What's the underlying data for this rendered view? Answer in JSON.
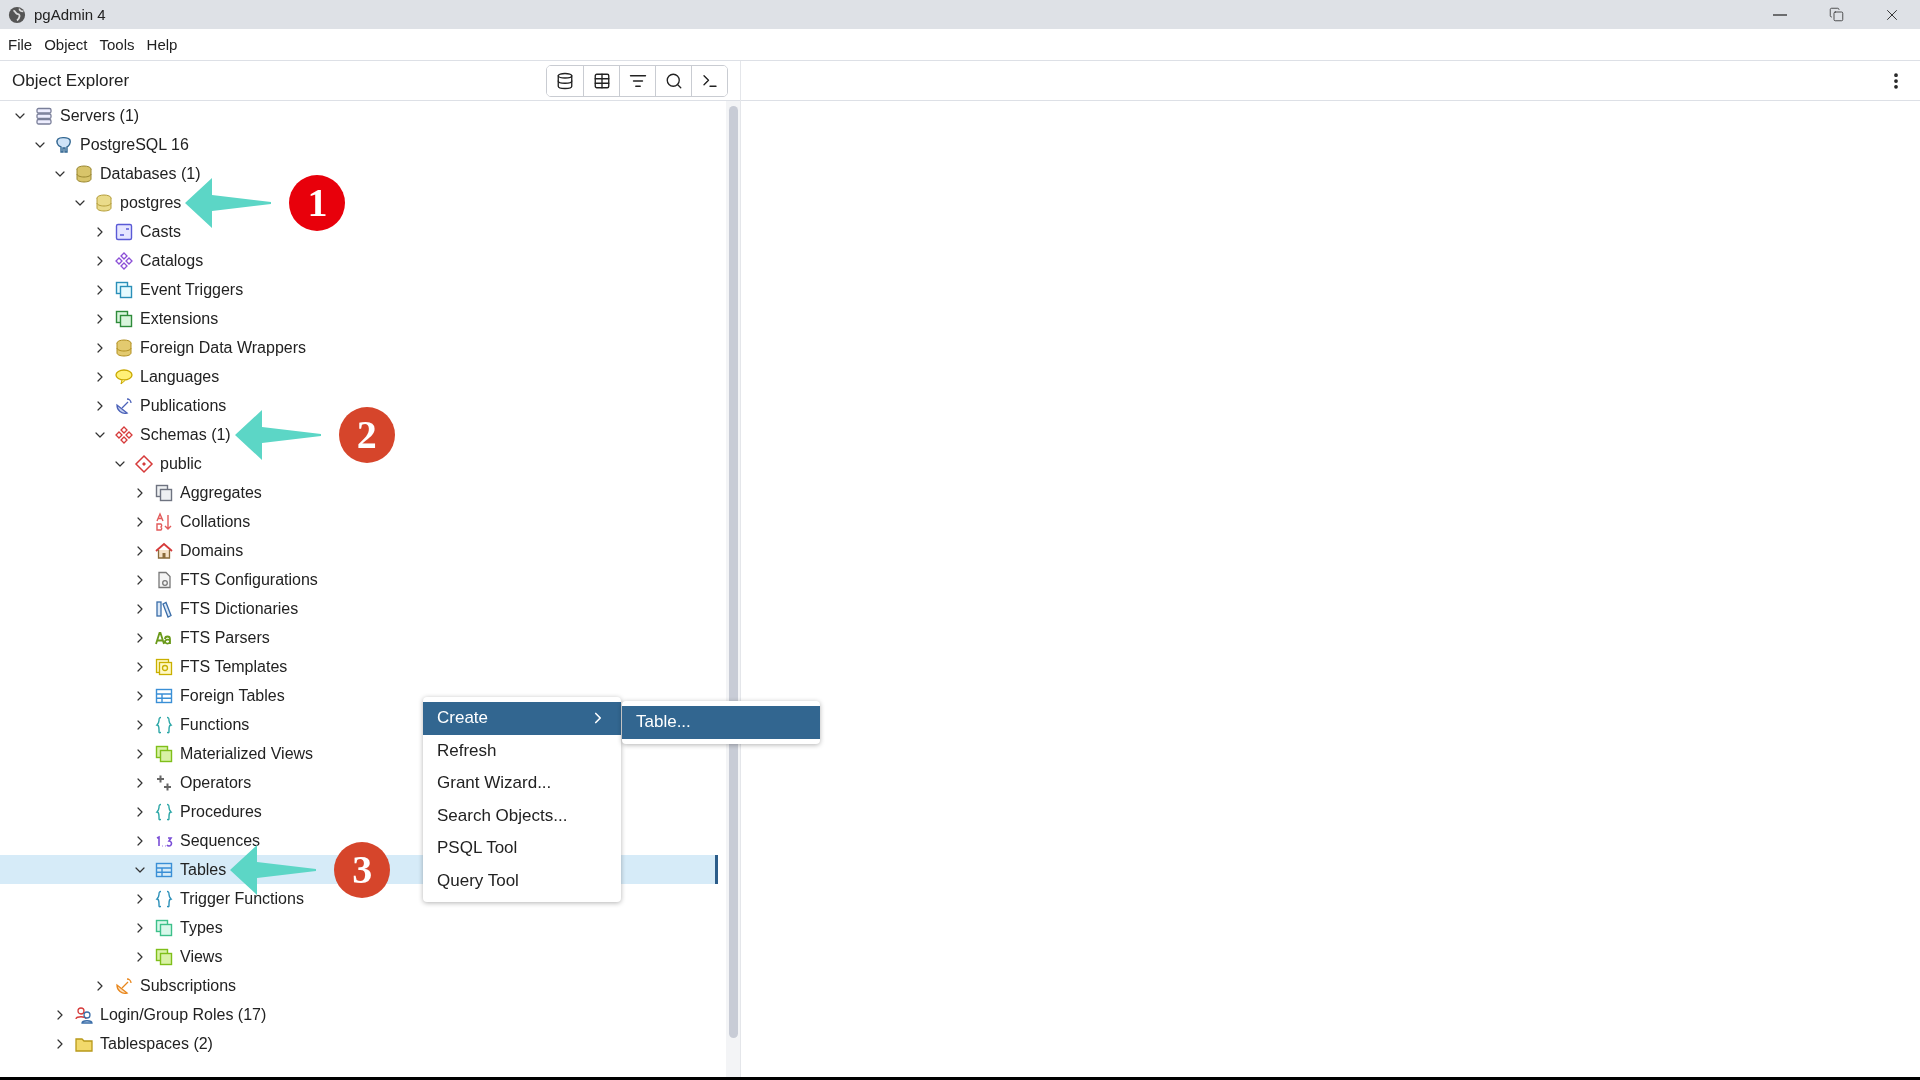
{
  "window": {
    "title": "pgAdmin 4"
  },
  "menu": [
    "File",
    "Object",
    "Tools",
    "Help"
  ],
  "explorer": {
    "title": "Object Explorer",
    "tree": [
      {
        "label": "Servers (1)",
        "kind": "servers",
        "expanded": true,
        "selected": false,
        "children": [
          {
            "label": "PostgreSQL 16",
            "kind": "server",
            "expanded": true,
            "selected": false,
            "children": [
              {
                "label": "Databases (1)",
                "kind": "databases",
                "expanded": true,
                "selected": false,
                "children": [
                  {
                    "label": "postgres",
                    "kind": "database",
                    "expanded": true,
                    "selected": false,
                    "callout": {
                      "label": "1",
                      "color": "#e8000b"
                    },
                    "children": [
                      {
                        "label": "Casts",
                        "kind": "casts",
                        "expanded": false,
                        "selected": false
                      },
                      {
                        "label": "Catalogs",
                        "kind": "catalogs",
                        "expanded": false,
                        "selected": false
                      },
                      {
                        "label": "Event Triggers",
                        "kind": "event_triggers",
                        "expanded": false,
                        "selected": false
                      },
                      {
                        "label": "Extensions",
                        "kind": "extensions",
                        "expanded": false,
                        "selected": false
                      },
                      {
                        "label": "Foreign Data Wrappers",
                        "kind": "fdw",
                        "expanded": false,
                        "selected": false
                      },
                      {
                        "label": "Languages",
                        "kind": "languages",
                        "expanded": false,
                        "selected": false
                      },
                      {
                        "label": "Publications",
                        "kind": "publications",
                        "expanded": false,
                        "selected": false
                      },
                      {
                        "label": "Schemas (1)",
                        "kind": "schemas",
                        "expanded": true,
                        "selected": false,
                        "callout": {
                          "label": "2",
                          "color": "#d6452b"
                        },
                        "children": [
                          {
                            "label": "public",
                            "kind": "schema",
                            "expanded": true,
                            "selected": false,
                            "children": [
                              {
                                "label": "Aggregates",
                                "kind": "aggregates",
                                "expanded": false,
                                "selected": false
                              },
                              {
                                "label": "Collations",
                                "kind": "collations",
                                "expanded": false,
                                "selected": false
                              },
                              {
                                "label": "Domains",
                                "kind": "domains",
                                "expanded": false,
                                "selected": false
                              },
                              {
                                "label": "FTS Configurations",
                                "kind": "fts_config",
                                "expanded": false,
                                "selected": false
                              },
                              {
                                "label": "FTS Dictionaries",
                                "kind": "fts_dict",
                                "expanded": false,
                                "selected": false
                              },
                              {
                                "label": "FTS Parsers",
                                "kind": "fts_parser",
                                "expanded": false,
                                "selected": false
                              },
                              {
                                "label": "FTS Templates",
                                "kind": "fts_template",
                                "expanded": false,
                                "selected": false
                              },
                              {
                                "label": "Foreign Tables",
                                "kind": "foreign_tables",
                                "expanded": false,
                                "selected": false
                              },
                              {
                                "label": "Functions",
                                "kind": "functions",
                                "expanded": false,
                                "selected": false
                              },
                              {
                                "label": "Materialized Views",
                                "kind": "mviews",
                                "expanded": false,
                                "selected": false
                              },
                              {
                                "label": "Operators",
                                "kind": "operators",
                                "expanded": false,
                                "selected": false
                              },
                              {
                                "label": "Procedures",
                                "kind": "procedures",
                                "expanded": false,
                                "selected": false
                              },
                              {
                                "label": "Sequences",
                                "kind": "sequences",
                                "expanded": false,
                                "selected": false
                              },
                              {
                                "label": "Tables",
                                "kind": "tables",
                                "expanded": true,
                                "selected": true,
                                "callout": {
                                  "label": "3",
                                  "color": "#d6452b"
                                }
                              },
                              {
                                "label": "Trigger Functions",
                                "kind": "trigger_functions",
                                "expanded": false,
                                "selected": false
                              },
                              {
                                "label": "Types",
                                "kind": "types",
                                "expanded": false,
                                "selected": false
                              },
                              {
                                "label": "Views",
                                "kind": "views",
                                "expanded": false,
                                "selected": false
                              }
                            ]
                          }
                        ]
                      },
                      {
                        "label": "Subscriptions",
                        "kind": "subscriptions",
                        "expanded": false,
                        "selected": false
                      }
                    ]
                  }
                ]
              },
              {
                "label": "Login/Group Roles (17)",
                "kind": "roles",
                "expanded": false,
                "selected": false
              },
              {
                "label": "Tablespaces (2)",
                "kind": "tablespaces",
                "expanded": false,
                "selected": false
              }
            ]
          }
        ]
      }
    ]
  },
  "context_menu": {
    "items": [
      {
        "label": "Create",
        "selected": true,
        "has_submenu": true
      },
      {
        "label": "Refresh",
        "selected": false,
        "has_submenu": false
      },
      {
        "label": "Grant Wizard...",
        "selected": false,
        "has_submenu": false
      },
      {
        "label": "Search Objects...",
        "selected": false,
        "has_submenu": false
      },
      {
        "label": "PSQL Tool",
        "selected": false,
        "has_submenu": false
      },
      {
        "label": "Query Tool",
        "selected": false,
        "has_submenu": false
      }
    ],
    "submenu": [
      {
        "label": "Table...",
        "selected": true
      }
    ]
  }
}
